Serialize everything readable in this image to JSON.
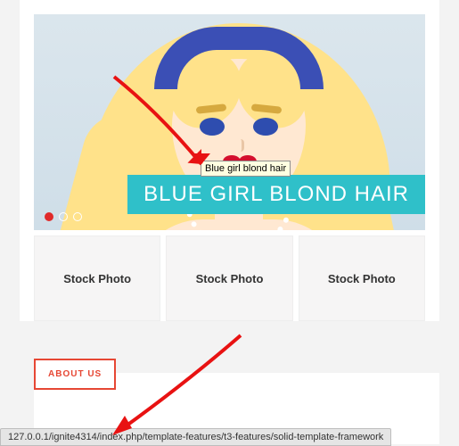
{
  "hero": {
    "caption": "BLUE GIRL BLOND HAIR",
    "tooltip": "Blue girl blond hair",
    "dots_count": 3,
    "active_dot_index": 0
  },
  "thumbs": [
    {
      "label": "Stock Photo"
    },
    {
      "label": "Stock Photo"
    },
    {
      "label": "Stock Photo"
    }
  ],
  "about": {
    "tab_label": "ABOUT US"
  },
  "statusbar": {
    "url": "127.0.0.1/ignite4314/index.php/template-features/t3-features/solid-template-framework"
  }
}
